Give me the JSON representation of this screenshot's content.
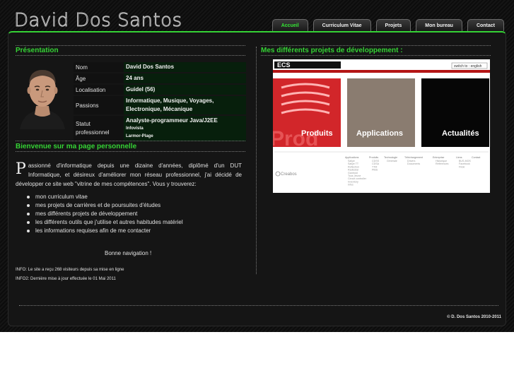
{
  "header": {
    "site_title": "David Dos Santos"
  },
  "nav": {
    "tabs": [
      {
        "label": "Accueil",
        "active": true
      },
      {
        "label": "Curriculum Vitae",
        "active": false
      },
      {
        "label": "Projets",
        "active": false
      },
      {
        "label": "Mon bureau",
        "active": false
      },
      {
        "label": "Contact",
        "active": false
      }
    ]
  },
  "presentation": {
    "title": "Présentation",
    "rows": [
      {
        "label": "Nom",
        "value": "David Dos Santos"
      },
      {
        "label": "Âge",
        "value": "24 ans"
      },
      {
        "label": "Localisation",
        "value": "Guidel (56)"
      },
      {
        "label": "Passions",
        "value": "Informatique, Musique, Voyages, Electronique, Mécanique"
      },
      {
        "label": "Statut professionnel",
        "value": "Analyste-programmeur Java/J2EE",
        "sub1": "Infovista",
        "sub2": "Larmor-Plage"
      }
    ]
  },
  "welcome": {
    "title": "Bienvenue sur ma page personnelle",
    "dropcap": "P",
    "intro": "assionné d'informatique depuis une dizaine d'années, diplômé d'un DUT Informatique, et désireux d'améliorer mon réseau professionnel, j'ai décidé de développer ce site web \"vitrine de mes compétences\". Vous y trouverez:",
    "bullets": [
      "mon curriculum vitae",
      "mes projets de carrières et de poursuites d'études",
      "mes différents projets de développement",
      "les différents outils que j'utilise et autres habitudes matériel",
      "les informations requises afin de me contacter"
    ],
    "closing": "Bonne navigation !",
    "info1": "INFO: Le site a reçu 268 visiteurs depuis sa mise en ligne",
    "info2": "INFO2: Dernière mise à jour effectuée le 01 Mai 2011"
  },
  "projects": {
    "title": "Mes différents projets de développement :",
    "shot": {
      "logo": "ECS",
      "switch_label": "switch to : english",
      "tiles": [
        "Produits",
        "Applications",
        "Actualités"
      ],
      "watermark": "Prod",
      "brand": "Creabos",
      "columns": [
        {
          "head": "Applications",
          "items": [
            "Sallye",
            "Sallye TT",
            "Reflection",
            "Radiostar",
            "Gantroid",
            "Tous Jeune",
            "Circuit controller",
            "Inventory",
            "Infos"
          ]
        },
        {
          "head": "Produits",
          "items": [
            "CDSS",
            "CDSA",
            "TTM",
            "PIBS"
          ]
        },
        {
          "head": "Technologie",
          "items": [
            "Générale"
          ]
        },
        {
          "head": "Téléchargement",
          "items": [
            "Drivers",
            "Documents"
          ]
        },
        {
          "head": "Entreprise",
          "items": [
            "Historique",
            "Références"
          ]
        },
        {
          "head": "Liens",
          "items": [
            "BUS-MOS",
            "Facebook",
            "Flickr"
          ]
        },
        {
          "head": "Contact",
          "items": []
        }
      ]
    }
  },
  "footer": {
    "copyright": "© D. Dos Santos 2010-2011"
  },
  "colors": {
    "accent": "#35d335",
    "background": "#0e0e0e",
    "table_value_bg": "#071f0c"
  }
}
